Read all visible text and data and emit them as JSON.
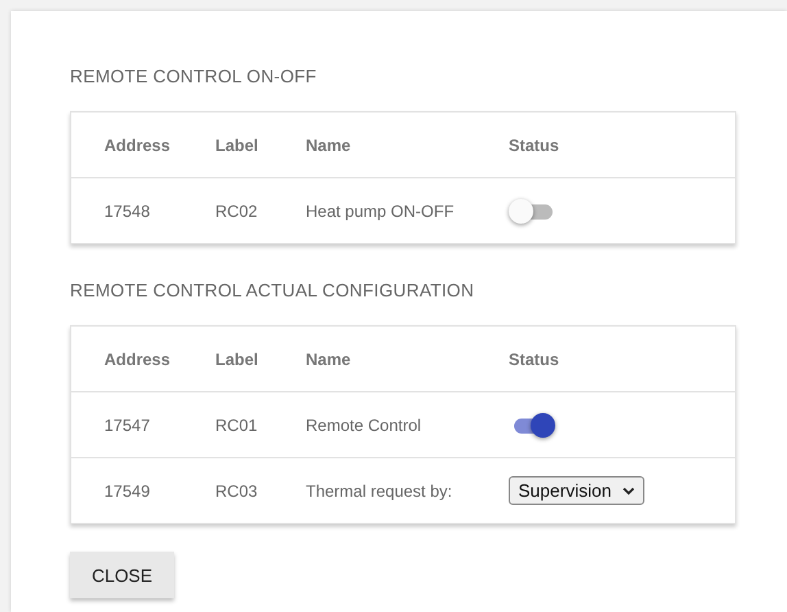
{
  "sections": [
    {
      "title": "REMOTE CONTROL ON-OFF",
      "columns": [
        "Address",
        "Label",
        "Name",
        "Status"
      ],
      "rows": [
        {
          "address": "17548",
          "label": "RC02",
          "name": "Heat pump ON-OFF",
          "kind": "toggle",
          "on": false
        }
      ]
    },
    {
      "title": "REMOTE CONTROL ACTUAL CONFIGURATION",
      "columns": [
        "Address",
        "Label",
        "Name",
        "Status"
      ],
      "rows": [
        {
          "address": "17547",
          "label": "RC01",
          "name": "Remote Control",
          "kind": "toggle",
          "on": true
        },
        {
          "address": "17549",
          "label": "RC03",
          "name": "Thermal request by:",
          "kind": "select",
          "value": "Supervision"
        }
      ]
    }
  ],
  "close_button": "CLOSE"
}
